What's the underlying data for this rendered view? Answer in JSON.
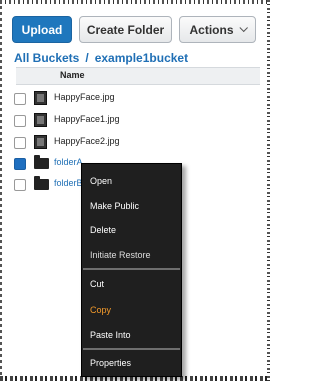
{
  "toolbar": {
    "upload_label": "Upload",
    "create_folder_label": "Create Folder",
    "actions_label": "Actions"
  },
  "breadcrumb": {
    "root": "All Buckets",
    "separator": "/",
    "current": "example1bucket"
  },
  "table": {
    "column_name": "Name",
    "rows": [
      {
        "name": "HappyFace.jpg",
        "type": "file",
        "checked": false
      },
      {
        "name": "HappyFace1.jpg",
        "type": "file",
        "checked": false
      },
      {
        "name": "HappyFace2.jpg",
        "type": "file",
        "checked": false
      },
      {
        "name": "folderA",
        "type": "folder",
        "checked": true
      },
      {
        "name": "folderB",
        "type": "folder",
        "checked": false
      }
    ]
  },
  "context_menu": {
    "items": [
      {
        "label": "Open"
      },
      {
        "label": "Make Public"
      },
      {
        "label": "Delete"
      },
      {
        "label": "Initiate Restore"
      },
      {
        "label": "Cut"
      },
      {
        "label": "Copy"
      },
      {
        "label": "Paste Into"
      },
      {
        "label": "Properties"
      }
    ]
  },
  "colors": {
    "primary_button": "#1f77bd",
    "link": "#1f6fb5",
    "menu_background": "#1f1f1f",
    "menu_highlight": "#f39a2b"
  },
  "icons": [
    "file-icon",
    "folder-icon",
    "chevron-down-icon",
    "checkbox"
  ]
}
